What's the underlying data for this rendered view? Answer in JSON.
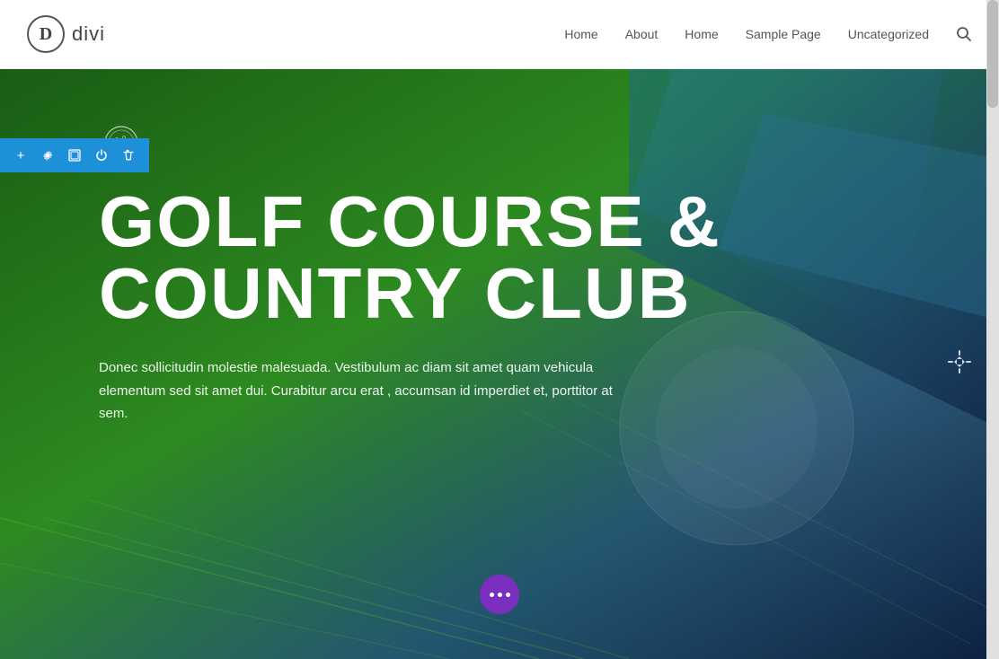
{
  "header": {
    "logo_letter": "D",
    "logo_name": "divi",
    "nav": {
      "items": [
        {
          "label": "Home",
          "id": "nav-home-1"
        },
        {
          "label": "About",
          "id": "nav-about"
        },
        {
          "label": "Home",
          "id": "nav-home-2"
        },
        {
          "label": "Sample Page",
          "id": "nav-sample-page"
        },
        {
          "label": "Uncategorized",
          "id": "nav-uncategorized"
        }
      ]
    }
  },
  "toolbar": {
    "buttons": [
      {
        "label": "+",
        "name": "add-button",
        "title": "Add"
      },
      {
        "label": "⚙",
        "name": "settings-button",
        "title": "Settings"
      },
      {
        "label": "⊡",
        "name": "layout-button",
        "title": "Layout"
      },
      {
        "label": "⏻",
        "name": "toggle-button",
        "title": "Toggle"
      },
      {
        "label": "🗑",
        "name": "delete-button",
        "title": "Delete"
      }
    ]
  },
  "hero": {
    "golf_icon_alt": "golf ball icon",
    "title_line1": "GOLF COURSE &",
    "title_line2": "COUNTRY CLUB",
    "description": "Donec sollicitudin molestie malesuada. Vestibulum ac diam sit amet quam vehicula elementum sed sit amet dui. Curabitur arcu erat , accumsan id imperdiet et, porttitor at sem.",
    "dots_button_label": "...",
    "move_icon": "✛"
  },
  "colors": {
    "toolbar_bg": "#1e90d8",
    "hero_title_color": "#ffffff",
    "hero_desc_color": "rgba(255,255,255,0.92)",
    "dots_bg": "#7b2fbe"
  }
}
